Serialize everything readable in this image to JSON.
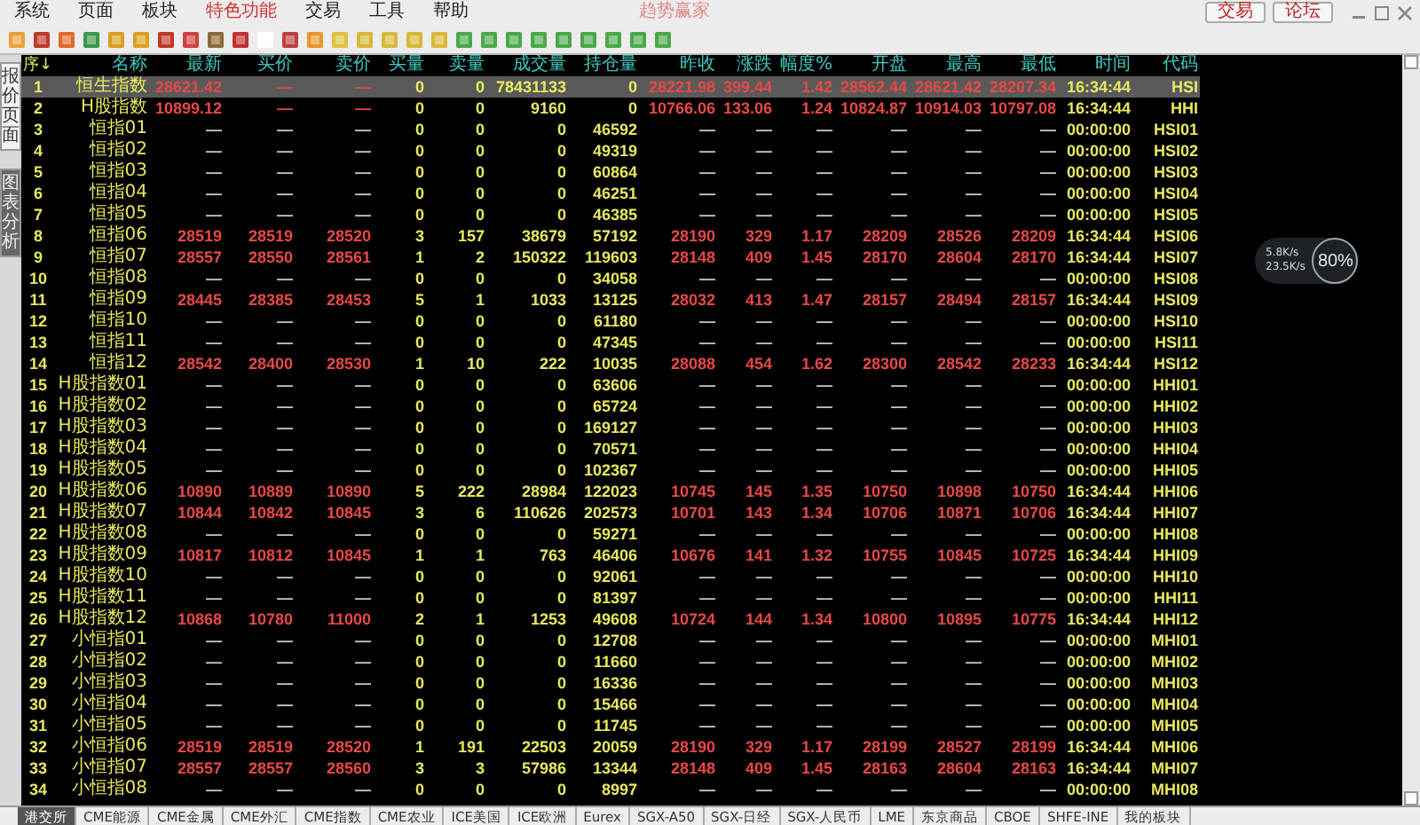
{
  "menu": [
    {
      "label": "系统",
      "selected": false
    },
    {
      "label": "页面",
      "selected": false
    },
    {
      "label": "板块",
      "selected": false
    },
    {
      "label": "特色功能",
      "selected": true
    },
    {
      "label": "交易",
      "selected": false
    },
    {
      "label": "工具",
      "selected": false
    },
    {
      "label": "帮助",
      "selected": false
    }
  ],
  "window": {
    "title": "趋势赢家"
  },
  "top_buttons": [
    "交易",
    "论坛"
  ],
  "side_tabs": [
    {
      "label": "报价页面",
      "selected": true
    },
    {
      "label": "图表分析",
      "selected": false
    }
  ],
  "columns": [
    "序↓",
    "名称",
    "最新",
    "买价",
    "卖价",
    "买量",
    "卖量",
    "成交量",
    "持仓量",
    "昨收",
    "涨跌",
    "幅度%",
    "开盘",
    "最高",
    "最低",
    "时间",
    "代码"
  ],
  "rows": [
    {
      "selected": true,
      "traded": true,
      "cells": [
        "1",
        "恒生指数",
        "28621.42",
        "—",
        "—",
        "0",
        "0",
        "78431133",
        "0",
        "28221.98",
        "399.44",
        "1.42",
        "28562.44",
        "28621.42",
        "28207.34",
        "16:34:44",
        "HSI"
      ]
    },
    {
      "selected": false,
      "traded": true,
      "cells": [
        "2",
        "H股指数",
        "10899.12",
        "—",
        "—",
        "0",
        "0",
        "9160",
        "0",
        "10766.06",
        "133.06",
        "1.24",
        "10824.87",
        "10914.03",
        "10797.08",
        "16:34:44",
        "HHI"
      ]
    },
    {
      "selected": false,
      "traded": false,
      "cells": [
        "3",
        "恒指01",
        "—",
        "—",
        "—",
        "0",
        "0",
        "0",
        "46592",
        "—",
        "—",
        "—",
        "—",
        "—",
        "—",
        "00:00:00",
        "HSI01"
      ]
    },
    {
      "selected": false,
      "traded": false,
      "cells": [
        "4",
        "恒指02",
        "—",
        "—",
        "—",
        "0",
        "0",
        "0",
        "49319",
        "—",
        "—",
        "—",
        "—",
        "—",
        "—",
        "00:00:00",
        "HSI02"
      ]
    },
    {
      "selected": false,
      "traded": false,
      "cells": [
        "5",
        "恒指03",
        "—",
        "—",
        "—",
        "0",
        "0",
        "0",
        "60864",
        "—",
        "—",
        "—",
        "—",
        "—",
        "—",
        "00:00:00",
        "HSI03"
      ]
    },
    {
      "selected": false,
      "traded": false,
      "cells": [
        "6",
        "恒指04",
        "—",
        "—",
        "—",
        "0",
        "0",
        "0",
        "46251",
        "—",
        "—",
        "—",
        "—",
        "—",
        "—",
        "00:00:00",
        "HSI04"
      ]
    },
    {
      "selected": false,
      "traded": false,
      "cells": [
        "7",
        "恒指05",
        "—",
        "—",
        "—",
        "0",
        "0",
        "0",
        "46385",
        "—",
        "—",
        "—",
        "—",
        "—",
        "—",
        "00:00:00",
        "HSI05"
      ]
    },
    {
      "selected": false,
      "traded": true,
      "cells": [
        "8",
        "恒指06",
        "28519",
        "28519",
        "28520",
        "3",
        "157",
        "38679",
        "57192",
        "28190",
        "329",
        "1.17",
        "28209",
        "28526",
        "28209",
        "16:34:44",
        "HSI06"
      ]
    },
    {
      "selected": false,
      "traded": true,
      "cells": [
        "9",
        "恒指07",
        "28557",
        "28550",
        "28561",
        "1",
        "2",
        "150322",
        "119603",
        "28148",
        "409",
        "1.45",
        "28170",
        "28604",
        "28170",
        "16:34:44",
        "HSI07"
      ]
    },
    {
      "selected": false,
      "traded": false,
      "cells": [
        "10",
        "恒指08",
        "—",
        "—",
        "—",
        "0",
        "0",
        "0",
        "34058",
        "—",
        "—",
        "—",
        "—",
        "—",
        "—",
        "00:00:00",
        "HSI08"
      ]
    },
    {
      "selected": false,
      "traded": true,
      "cells": [
        "11",
        "恒指09",
        "28445",
        "28385",
        "28453",
        "5",
        "1",
        "1033",
        "13125",
        "28032",
        "413",
        "1.47",
        "28157",
        "28494",
        "28157",
        "16:34:44",
        "HSI09"
      ]
    },
    {
      "selected": false,
      "traded": false,
      "cells": [
        "12",
        "恒指10",
        "—",
        "—",
        "—",
        "0",
        "0",
        "0",
        "61180",
        "—",
        "—",
        "—",
        "—",
        "—",
        "—",
        "00:00:00",
        "HSI10"
      ]
    },
    {
      "selected": false,
      "traded": false,
      "cells": [
        "13",
        "恒指11",
        "—",
        "—",
        "—",
        "0",
        "0",
        "0",
        "47345",
        "—",
        "—",
        "—",
        "—",
        "—",
        "—",
        "00:00:00",
        "HSI11"
      ]
    },
    {
      "selected": false,
      "traded": true,
      "cells": [
        "14",
        "恒指12",
        "28542",
        "28400",
        "28530",
        "1",
        "10",
        "222",
        "10035",
        "28088",
        "454",
        "1.62",
        "28300",
        "28542",
        "28233",
        "16:34:44",
        "HSI12"
      ]
    },
    {
      "selected": false,
      "traded": false,
      "cells": [
        "15",
        "H股指数01",
        "—",
        "—",
        "—",
        "0",
        "0",
        "0",
        "63606",
        "—",
        "—",
        "—",
        "—",
        "—",
        "—",
        "00:00:00",
        "HHI01"
      ]
    },
    {
      "selected": false,
      "traded": false,
      "cells": [
        "16",
        "H股指数02",
        "—",
        "—",
        "—",
        "0",
        "0",
        "0",
        "65724",
        "—",
        "—",
        "—",
        "—",
        "—",
        "—",
        "00:00:00",
        "HHI02"
      ]
    },
    {
      "selected": false,
      "traded": false,
      "cells": [
        "17",
        "H股指数03",
        "—",
        "—",
        "—",
        "0",
        "0",
        "0",
        "169127",
        "—",
        "—",
        "—",
        "—",
        "—",
        "—",
        "00:00:00",
        "HHI03"
      ]
    },
    {
      "selected": false,
      "traded": false,
      "cells": [
        "18",
        "H股指数04",
        "—",
        "—",
        "—",
        "0",
        "0",
        "0",
        "70571",
        "—",
        "—",
        "—",
        "—",
        "—",
        "—",
        "00:00:00",
        "HHI04"
      ]
    },
    {
      "selected": false,
      "traded": false,
      "cells": [
        "19",
        "H股指数05",
        "—",
        "—",
        "—",
        "0",
        "0",
        "0",
        "102367",
        "—",
        "—",
        "—",
        "—",
        "—",
        "—",
        "00:00:00",
        "HHI05"
      ]
    },
    {
      "selected": false,
      "traded": true,
      "cells": [
        "20",
        "H股指数06",
        "10890",
        "10889",
        "10890",
        "5",
        "222",
        "28984",
        "122023",
        "10745",
        "145",
        "1.35",
        "10750",
        "10898",
        "10750",
        "16:34:44",
        "HHI06"
      ]
    },
    {
      "selected": false,
      "traded": true,
      "cells": [
        "21",
        "H股指数07",
        "10844",
        "10842",
        "10845",
        "3",
        "6",
        "110626",
        "202573",
        "10701",
        "143",
        "1.34",
        "10706",
        "10871",
        "10706",
        "16:34:44",
        "HHI07"
      ]
    },
    {
      "selected": false,
      "traded": false,
      "cells": [
        "22",
        "H股指数08",
        "—",
        "—",
        "—",
        "0",
        "0",
        "0",
        "59271",
        "—",
        "—",
        "—",
        "—",
        "—",
        "—",
        "00:00:00",
        "HHI08"
      ]
    },
    {
      "selected": false,
      "traded": true,
      "cells": [
        "23",
        "H股指数09",
        "10817",
        "10812",
        "10845",
        "1",
        "1",
        "763",
        "46406",
        "10676",
        "141",
        "1.32",
        "10755",
        "10845",
        "10725",
        "16:34:44",
        "HHI09"
      ]
    },
    {
      "selected": false,
      "traded": false,
      "cells": [
        "24",
        "H股指数10",
        "—",
        "—",
        "—",
        "0",
        "0",
        "0",
        "92061",
        "—",
        "—",
        "—",
        "—",
        "—",
        "—",
        "00:00:00",
        "HHI10"
      ]
    },
    {
      "selected": false,
      "traded": false,
      "cells": [
        "25",
        "H股指数11",
        "—",
        "—",
        "—",
        "0",
        "0",
        "0",
        "81397",
        "—",
        "—",
        "—",
        "—",
        "—",
        "—",
        "00:00:00",
        "HHI11"
      ]
    },
    {
      "selected": false,
      "traded": true,
      "cells": [
        "26",
        "H股指数12",
        "10868",
        "10780",
        "11000",
        "2",
        "1",
        "1253",
        "49608",
        "10724",
        "144",
        "1.34",
        "10800",
        "10895",
        "10775",
        "16:34:44",
        "HHI12"
      ]
    },
    {
      "selected": false,
      "traded": false,
      "cells": [
        "27",
        "小恒指01",
        "—",
        "—",
        "—",
        "0",
        "0",
        "0",
        "12708",
        "—",
        "—",
        "—",
        "—",
        "—",
        "—",
        "00:00:00",
        "MHI01"
      ]
    },
    {
      "selected": false,
      "traded": false,
      "cells": [
        "28",
        "小恒指02",
        "—",
        "—",
        "—",
        "0",
        "0",
        "0",
        "11660",
        "—",
        "—",
        "—",
        "—",
        "—",
        "—",
        "00:00:00",
        "MHI02"
      ]
    },
    {
      "selected": false,
      "traded": false,
      "cells": [
        "29",
        "小恒指03",
        "—",
        "—",
        "—",
        "0",
        "0",
        "0",
        "16336",
        "—",
        "—",
        "—",
        "—",
        "—",
        "—",
        "00:00:00",
        "MHI03"
      ]
    },
    {
      "selected": false,
      "traded": false,
      "cells": [
        "30",
        "小恒指04",
        "—",
        "—",
        "—",
        "0",
        "0",
        "0",
        "15466",
        "—",
        "—",
        "—",
        "—",
        "—",
        "—",
        "00:00:00",
        "MHI04"
      ]
    },
    {
      "selected": false,
      "traded": false,
      "cells": [
        "31",
        "小恒指05",
        "—",
        "—",
        "—",
        "0",
        "0",
        "0",
        "11745",
        "—",
        "—",
        "—",
        "—",
        "—",
        "—",
        "00:00:00",
        "MHI05"
      ]
    },
    {
      "selected": false,
      "traded": true,
      "cells": [
        "32",
        "小恒指06",
        "28519",
        "28519",
        "28520",
        "1",
        "191",
        "22503",
        "20059",
        "28190",
        "329",
        "1.17",
        "28199",
        "28527",
        "28199",
        "16:34:44",
        "MHI06"
      ]
    },
    {
      "selected": false,
      "traded": true,
      "cells": [
        "33",
        "小恒指07",
        "28557",
        "28557",
        "28560",
        "3",
        "3",
        "57986",
        "13344",
        "28148",
        "409",
        "1.45",
        "28163",
        "28604",
        "28163",
        "16:34:44",
        "MHI07"
      ]
    },
    {
      "selected": false,
      "traded": false,
      "cells": [
        "34",
        "小恒指08",
        "—",
        "—",
        "—",
        "0",
        "0",
        "0",
        "8997",
        "—",
        "—",
        "—",
        "—",
        "—",
        "—",
        "00:00:00",
        "MHI08"
      ]
    }
  ],
  "network_widget": {
    "upload": "5.8K/s",
    "download": "23.5K/s",
    "usage": "80%"
  },
  "bottom_tabs": [
    {
      "label": "港交所",
      "selected": true
    },
    {
      "label": "CME能源",
      "selected": false
    },
    {
      "label": "CME金属",
      "selected": false
    },
    {
      "label": "CME外汇",
      "selected": false
    },
    {
      "label": "CME指数",
      "selected": false
    },
    {
      "label": "CME农业",
      "selected": false
    },
    {
      "label": "ICE美国",
      "selected": false
    },
    {
      "label": "ICE欧洲",
      "selected": false
    },
    {
      "label": "Eurex",
      "selected": false
    },
    {
      "label": "SGX-A50",
      "selected": false
    },
    {
      "label": "SGX-日经",
      "selected": false
    },
    {
      "label": "SGX-人民币",
      "selected": false
    },
    {
      "label": "LME",
      "selected": false
    },
    {
      "label": "东京商品",
      "selected": false
    },
    {
      "label": "CBOE",
      "selected": false
    },
    {
      "label": "SHFE-INE",
      "selected": false
    },
    {
      "label": "我的板块",
      "selected": false
    }
  ]
}
